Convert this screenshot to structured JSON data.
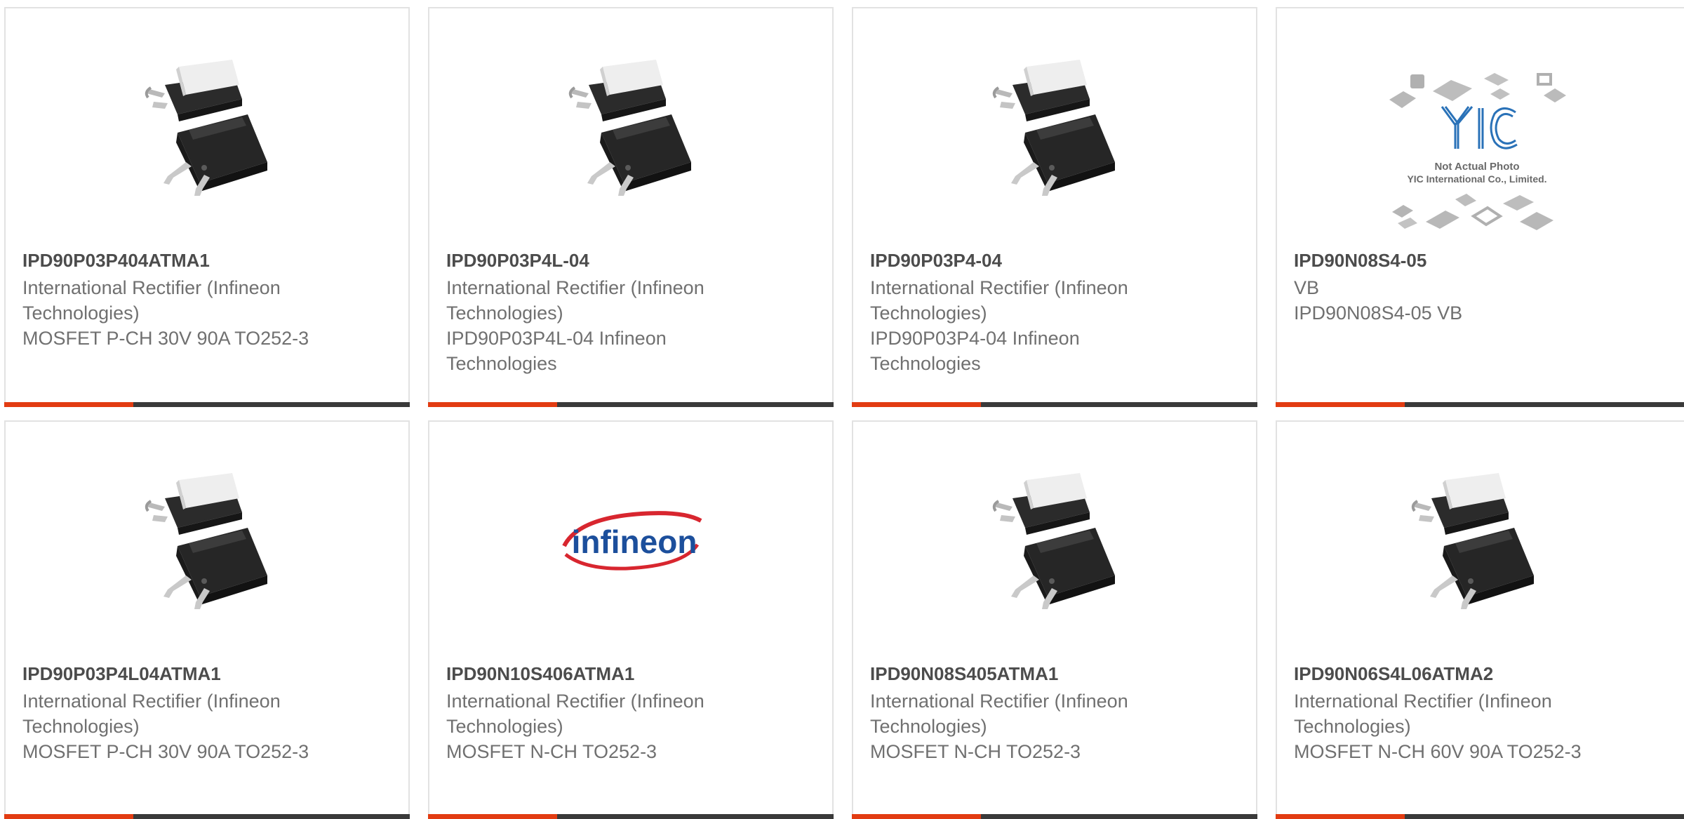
{
  "colors": {
    "accent": "#e23c12",
    "bar": "#3a3a3a",
    "title": "#4c4c4c",
    "text": "#707070",
    "border": "#e2e2e2"
  },
  "products": [
    {
      "part_number": "IPD90P03P404ATMA1",
      "manufacturer": "International Rectifier (Infineon Technologies)",
      "description": "MOSFET P-CH 30V 90A TO252-3",
      "image": "to252-package-photo"
    },
    {
      "part_number": "IPD90P03P4L-04",
      "manufacturer": "International Rectifier (Infineon Technologies)",
      "description": "IPD90P03P4L-04 Infineon Technologies",
      "image": "to252-package-photo"
    },
    {
      "part_number": "IPD90P03P4-04",
      "manufacturer": "International Rectifier (Infineon Technologies)",
      "description": "IPD90P03P4-04 Infineon Technologies",
      "image": "to252-package-photo"
    },
    {
      "part_number": "IPD90N08S4-05",
      "manufacturer": "VB",
      "description": "IPD90N08S4-05 VB",
      "image": "yic-placeholder",
      "placeholder_caption_1": "Not Actual Photo",
      "placeholder_caption_2": "YIC International Co., Limited."
    },
    {
      "part_number": "IPD90P03P4L04ATMA1",
      "manufacturer": "International Rectifier (Infineon Technologies)",
      "description": "MOSFET P-CH 30V 90A TO252-3",
      "image": "to252-package-photo"
    },
    {
      "part_number": "IPD90N10S406ATMA1",
      "manufacturer": "International Rectifier (Infineon Technologies)",
      "description": "MOSFET N-CH TO252-3",
      "image": "infineon-logo",
      "logo_text": "infineon"
    },
    {
      "part_number": "IPD90N08S405ATMA1",
      "manufacturer": "International Rectifier (Infineon Technologies)",
      "description": "MOSFET N-CH TO252-3",
      "image": "to252-package-photo"
    },
    {
      "part_number": "IPD90N06S4L06ATMA2",
      "manufacturer": "International Rectifier (Infineon Technologies)",
      "description": "MOSFET N-CH 60V 90A TO252-3",
      "image": "to252-package-photo"
    }
  ]
}
